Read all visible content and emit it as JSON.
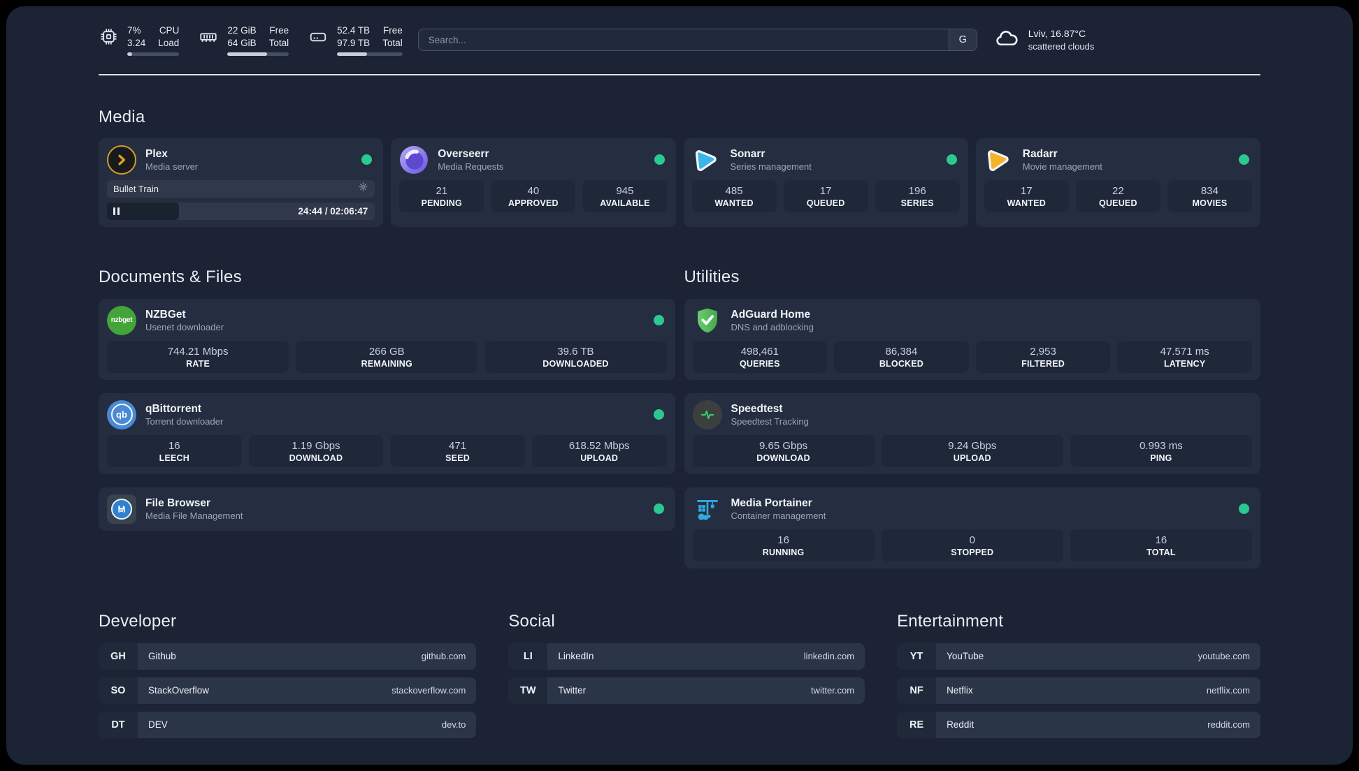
{
  "topbar": {
    "stats": [
      {
        "icon": "cpu-icon",
        "value_line1": "7%",
        "value_line2": "3.24",
        "label_line1": "CPU",
        "label_line2": "Load",
        "progress_pct": 10
      },
      {
        "icon": "memory-icon",
        "value_line1": "22 GiB",
        "value_line2": "64 GiB",
        "label_line1": "Free",
        "label_line2": "Total",
        "progress_pct": 65
      },
      {
        "icon": "disk-icon",
        "value_line1": "52.4 TB",
        "value_line2": "97.9 TB",
        "label_line1": "Free",
        "label_line2": "Total",
        "progress_pct": 46
      }
    ],
    "search": {
      "placeholder": "Search...",
      "engine_label": "G"
    },
    "weather": {
      "location_temp": "Lviv, 16.87°C",
      "condition": "scattered clouds"
    }
  },
  "media": {
    "title": "Media",
    "plex": {
      "name": "Plex",
      "subtitle": "Media server",
      "online": true,
      "player": {
        "now_playing": "Bullet Train",
        "time": "24:44 / 02:06:47",
        "progress_pct": 27
      }
    },
    "overseerr": {
      "name": "Overseerr",
      "subtitle": "Media Requests",
      "online": true,
      "stats": [
        {
          "value": "21",
          "label": "PENDING"
        },
        {
          "value": "40",
          "label": "APPROVED"
        },
        {
          "value": "945",
          "label": "AVAILABLE"
        }
      ]
    },
    "sonarr": {
      "name": "Sonarr",
      "subtitle": "Series management",
      "online": true,
      "stats": [
        {
          "value": "485",
          "label": "WANTED"
        },
        {
          "value": "17",
          "label": "QUEUED"
        },
        {
          "value": "196",
          "label": "SERIES"
        }
      ]
    },
    "radarr": {
      "name": "Radarr",
      "subtitle": "Movie management",
      "online": true,
      "stats": [
        {
          "value": "17",
          "label": "WANTED"
        },
        {
          "value": "22",
          "label": "QUEUED"
        },
        {
          "value": "834",
          "label": "MOVIES"
        }
      ]
    }
  },
  "documents": {
    "title": "Documents & Files",
    "nzbget": {
      "name": "NZBGet",
      "subtitle": "Usenet downloader",
      "online": true,
      "icon_text": "nzbget",
      "stats": [
        {
          "value": "744.21 Mbps",
          "label": "RATE"
        },
        {
          "value": "266 GB",
          "label": "REMAINING"
        },
        {
          "value": "39.6 TB",
          "label": "DOWNLOADED"
        }
      ]
    },
    "qbittorrent": {
      "name": "qBittorrent",
      "subtitle": "Torrent downloader",
      "online": true,
      "icon_text": "qb",
      "stats": [
        {
          "value": "16",
          "label": "LEECH"
        },
        {
          "value": "1.19 Gbps",
          "label": "DOWNLOAD"
        },
        {
          "value": "471",
          "label": "SEED"
        },
        {
          "value": "618.52 Mbps",
          "label": "UPLOAD"
        }
      ]
    },
    "filebrowser": {
      "name": "File Browser",
      "subtitle": "Media File Management",
      "online": true
    }
  },
  "utilities": {
    "title": "Utilities",
    "adguard": {
      "name": "AdGuard Home",
      "subtitle": "DNS and adblocking",
      "online": false,
      "stats": [
        {
          "value": "498,461",
          "label": "QUERIES"
        },
        {
          "value": "86,384",
          "label": "BLOCKED"
        },
        {
          "value": "2,953",
          "label": "FILTERED"
        },
        {
          "value": "47.571 ms",
          "label": "LATENCY"
        }
      ]
    },
    "speedtest": {
      "name": "Speedtest",
      "subtitle": "Speedtest Tracking",
      "online": false,
      "stats": [
        {
          "value": "9.65 Gbps",
          "label": "DOWNLOAD"
        },
        {
          "value": "9.24 Gbps",
          "label": "UPLOAD"
        },
        {
          "value": "0.993 ms",
          "label": "PING"
        }
      ]
    },
    "portainer": {
      "name": "Media Portainer",
      "subtitle": "Container management",
      "online": true,
      "stats": [
        {
          "value": "16",
          "label": "RUNNING"
        },
        {
          "value": "0",
          "label": "STOPPED"
        },
        {
          "value": "16",
          "label": "TOTAL"
        }
      ]
    }
  },
  "bookmarks": {
    "developer": {
      "title": "Developer",
      "links": [
        {
          "abbr": "GH",
          "name": "Github",
          "url": "github.com"
        },
        {
          "abbr": "SO",
          "name": "StackOverflow",
          "url": "stackoverflow.com"
        },
        {
          "abbr": "DT",
          "name": "DEV",
          "url": "dev.to"
        }
      ]
    },
    "social": {
      "title": "Social",
      "links": [
        {
          "abbr": "LI",
          "name": "LinkedIn",
          "url": "linkedin.com"
        },
        {
          "abbr": "TW",
          "name": "Twitter",
          "url": "twitter.com"
        }
      ]
    },
    "entertainment": {
      "title": "Entertainment",
      "links": [
        {
          "abbr": "YT",
          "name": "YouTube",
          "url": "youtube.com"
        },
        {
          "abbr": "NF",
          "name": "Netflix",
          "url": "netflix.com"
        },
        {
          "abbr": "RE",
          "name": "Reddit",
          "url": "reddit.com"
        }
      ]
    }
  },
  "colors": {
    "status_online": "#2bc990",
    "plex_amber": "#e9a21b",
    "overseerr_purple": "#6d5ce6",
    "sonarr_blue": "#3ab6e8",
    "radarr_yellow": "#f5b32a",
    "nzbget_green": "#44a339",
    "qbittorrent_blue": "#4a89d4",
    "adguard_green": "#57bf5e",
    "speedtest_green": "#35d36a",
    "portainer_blue": "#31a8e0",
    "background": "#1b2334",
    "card": "#252e40"
  }
}
